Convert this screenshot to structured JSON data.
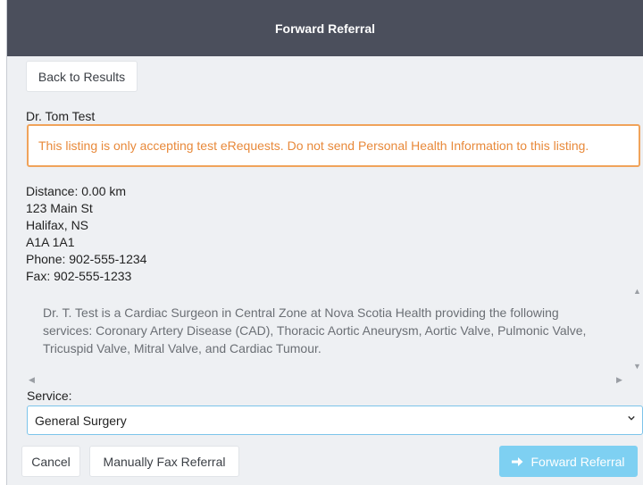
{
  "modal": {
    "title": "Forward Referral",
    "back_label": "Back to Results",
    "provider_name": "Dr. Tom Test",
    "alert_text": "This listing is only accepting test eRequests. Do not send Personal Health Information to this listing.",
    "address_lines": [
      "Distance: 0.00 km",
      "123 Main St",
      "Halifax, NS",
      "A1A 1A1",
      "Phone: 902-555-1234",
      "Fax: 902-555-1233"
    ],
    "description": "Dr. T. Test is a Cardiac Surgeon in Central Zone at Nova Scotia Health providing the following services: Coronary Artery Disease (CAD), Thoracic Aortic Aneurysm, Aortic Valve, Pulmonic Valve, Tricuspid Valve, Mitral Valve, and Cardiac Tumour.",
    "service_label": "Service:",
    "service_selected": "General Surgery",
    "cancel_label": "Cancel",
    "fax_label": "Manually Fax Referral",
    "forward_label": "Forward Referral"
  },
  "colors": {
    "header_bg": "#4b4f5c",
    "alert_border": "#f0a35a",
    "alert_text": "#e8893a",
    "select_border": "#7cc4ea",
    "forward_button": "#7ed0f2"
  }
}
